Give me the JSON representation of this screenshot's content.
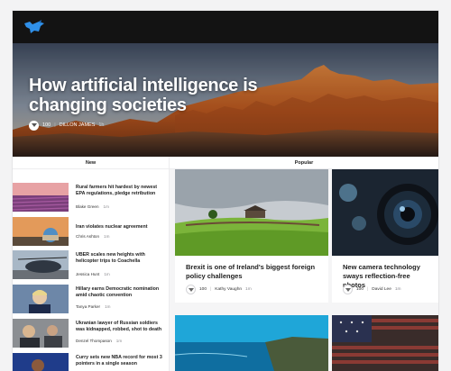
{
  "hero": {
    "title": "How artificial intelligence is changing societies",
    "votes": "100",
    "author": "DILLON JAMES",
    "time": "1h"
  },
  "new_column": {
    "heading": "New",
    "items": [
      {
        "title": "Rural farmers hit hardest by newest EPA regulations, pledge retribution",
        "author": "Blake Green",
        "time": "1m"
      },
      {
        "title": "Iran violates nuclear agreement",
        "author": "Chris Ashton",
        "time": "1m"
      },
      {
        "title": "UBER scales new heights with helicopter trips to Coachella",
        "author": "Jessica Hunt",
        "time": "1m"
      },
      {
        "title": "Hillary earns Democratic nomination amid chaotic convention",
        "author": "Tanya Parker",
        "time": "1m"
      },
      {
        "title": "Ukranian lawyer of Russian soldiers was kidnapped, robbed, shot to death",
        "author": "Denzel Thompason",
        "time": "1m"
      },
      {
        "title": "Curry sets new NBA record for most 3 pointers in a single season",
        "author": "",
        "time": ""
      }
    ]
  },
  "popular_column": {
    "heading": "Popular",
    "cards": [
      {
        "title": "Brexit is one of Ireland's biggest foreign policy challenges",
        "votes": "100",
        "author": "Kathy Vaughn",
        "time": "1m"
      },
      {
        "title": "New camera technology sways reflection-free photos",
        "votes": "100",
        "author": "David Lee",
        "time": "1m"
      }
    ]
  },
  "colors": {
    "topbar": "#131313",
    "logo": "#2f8fe8",
    "text": "#1e1e1e",
    "muted": "#8a8a8f"
  }
}
